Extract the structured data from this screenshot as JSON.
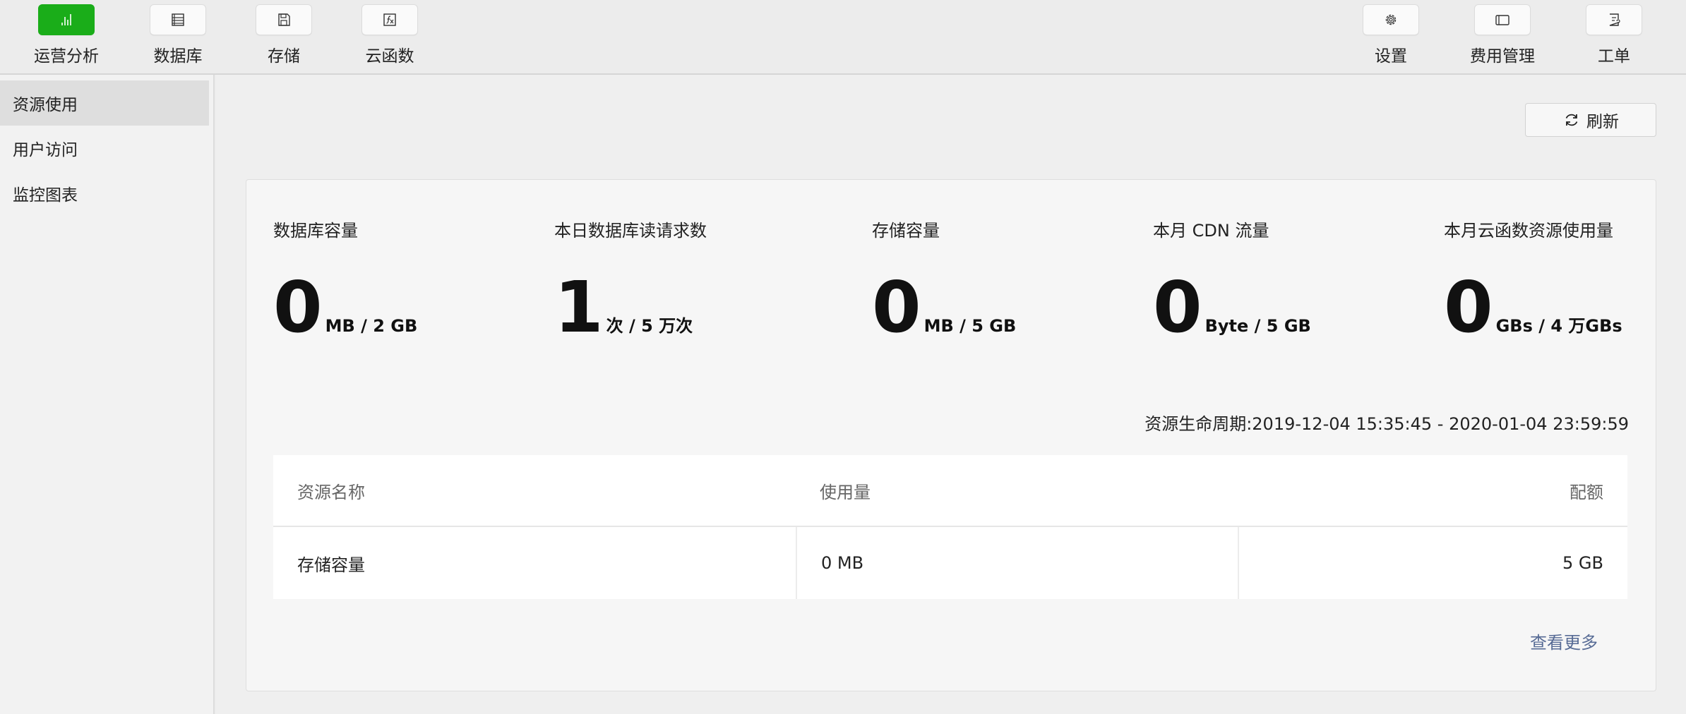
{
  "toolbar": {
    "left": [
      {
        "label": "运营分析",
        "icon": "bar-chart-icon"
      },
      {
        "label": "数据库",
        "icon": "database-icon"
      },
      {
        "label": "存储",
        "icon": "storage-icon"
      },
      {
        "label": "云函数",
        "icon": "cloud-function-icon"
      }
    ],
    "right": [
      {
        "label": "设置",
        "icon": "gear-icon"
      },
      {
        "label": "费用管理",
        "icon": "billing-icon"
      },
      {
        "label": "工单",
        "icon": "ticket-icon"
      }
    ]
  },
  "sidebar": {
    "items": [
      {
        "label": "资源使用"
      },
      {
        "label": "用户访问"
      },
      {
        "label": "监控图表"
      }
    ]
  },
  "main": {
    "refresh_label": "刷新",
    "stats": [
      {
        "title": "数据库容量",
        "value": "0",
        "unit": "MB / 2 GB"
      },
      {
        "title": "本日数据库读请求数",
        "value": "1",
        "unit": "次 / 5 万次"
      },
      {
        "title": "存储容量",
        "value": "0",
        "unit": "MB / 5 GB"
      },
      {
        "title": "本月 CDN 流量",
        "value": "0",
        "unit": "Byte / 5 GB"
      },
      {
        "title": "本月云函数资源使用量",
        "value": "0",
        "unit": "GBs / 4 万GBs"
      }
    ],
    "lifecycle": "资源生命周期:2019-12-04 15:35:45 - 2020-01-04 23:59:59",
    "table": {
      "headers": [
        "资源名称",
        "使用量",
        "配额"
      ],
      "rows": [
        [
          "存储容量",
          "0 MB",
          "5 GB"
        ]
      ]
    },
    "more_label": "查看更多"
  },
  "colors": {
    "accent": "#1aad19",
    "link": "#576b95"
  }
}
